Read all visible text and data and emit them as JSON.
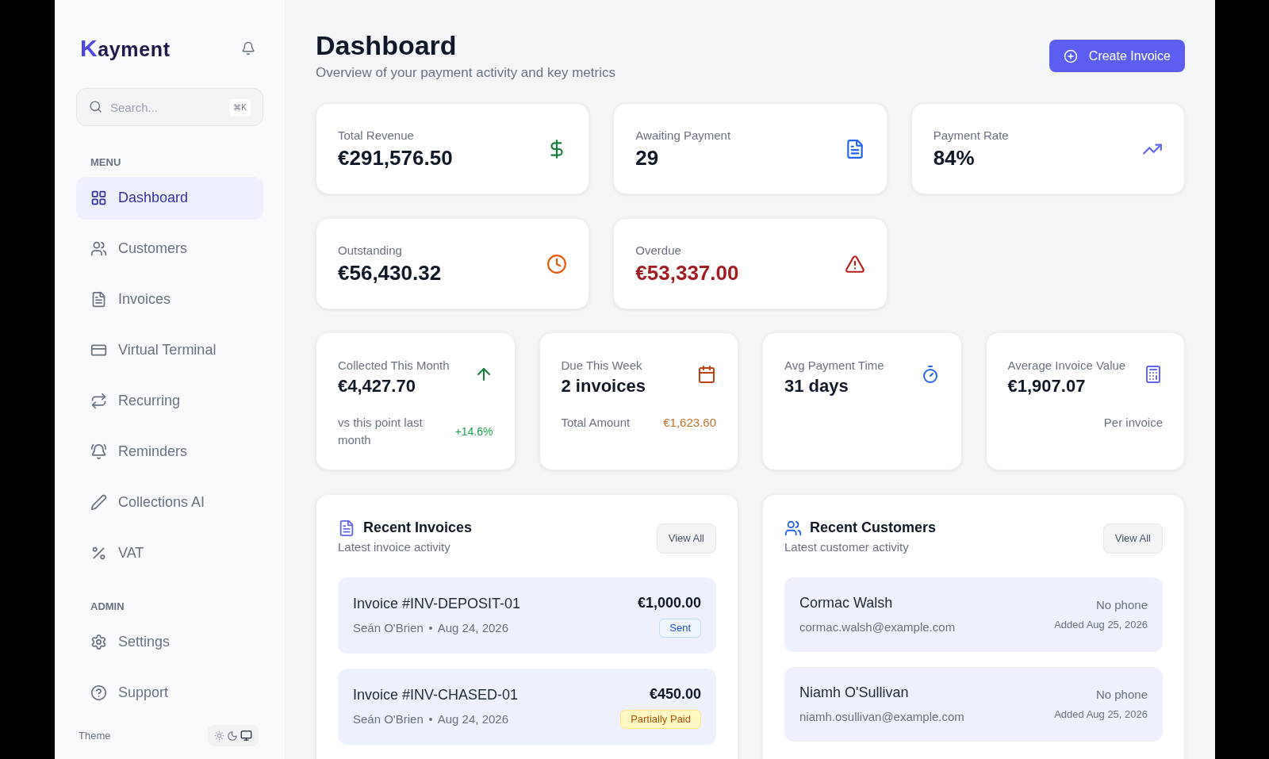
{
  "sidebar": {
    "brand": "Kayment",
    "search": {
      "placeholder": "Search...",
      "shortcut": "⌘K"
    },
    "sections": [
      {
        "title": "MENU",
        "items": [
          {
            "label": "Dashboard",
            "selected": true
          },
          {
            "label": "Customers",
            "selected": false
          },
          {
            "label": "Invoices",
            "selected": false
          },
          {
            "label": "Virtual Terminal",
            "selected": false
          },
          {
            "label": "Recurring",
            "selected": false
          },
          {
            "label": "Reminders",
            "selected": false
          },
          {
            "label": "Collections AI",
            "selected": false
          },
          {
            "label": "VAT",
            "selected": false
          }
        ]
      },
      {
        "title": "ADMIN",
        "items": [
          {
            "label": "Settings",
            "selected": false
          },
          {
            "label": "Support",
            "selected": false
          }
        ]
      }
    ],
    "theme_label": "Theme"
  },
  "header": {
    "title": "Dashboard",
    "subtitle": "Overview of your payment activity and key metrics",
    "action": "Create Invoice"
  },
  "metrics": [
    {
      "label": "Total Revenue",
      "value": "€291,576.50",
      "kind": "normal"
    },
    {
      "label": "Awaiting Payment",
      "value": "29",
      "kind": "normal"
    },
    {
      "label": "Payment Rate",
      "value": "84%",
      "kind": "normal"
    },
    {
      "label": "Outstanding",
      "value": "€56,430.32",
      "kind": "normal"
    },
    {
      "label": "Overdue",
      "value": "€53,337.00",
      "kind": "danger"
    }
  ],
  "details": [
    {
      "label": "Collected This Month",
      "value": "€4,427.70",
      "note": "vs this point last month",
      "extra": "+14.6%",
      "kind": "growth"
    },
    {
      "label": "Due This Week",
      "value": "2 invoices",
      "note": "Total Amount",
      "extra": "€1,623.60",
      "kind": "amount"
    },
    {
      "label": "Avg Payment Time",
      "value": "31 days",
      "kind": "plain"
    },
    {
      "label": "Average Invoice Value",
      "value": "€1,907.07",
      "extra": "Per invoice",
      "kind": "caption"
    }
  ],
  "recent_invoices": {
    "title": "Recent Invoices",
    "subtitle": "Latest invoice activity",
    "action": "View All",
    "items": [
      {
        "title": "Invoice #INV-DEPOSIT-01",
        "customer": "Seán O'Brien",
        "date": "Aug 24, 2026",
        "amount": "€1,000.00",
        "status": "Sent",
        "kind": "sent"
      },
      {
        "title": "Invoice #INV-CHASED-01",
        "customer": "Seán O'Brien",
        "date": "Aug 24, 2026",
        "amount": "€450.00",
        "status": "Partially Paid",
        "kind": "partial"
      }
    ]
  },
  "recent_customers": {
    "title": "Recent Customers",
    "subtitle": "Latest customer activity",
    "action": "View All",
    "items": [
      {
        "name": "Cormac Walsh",
        "email": "cormac.walsh@example.com",
        "phone": "No phone",
        "added": "Added Aug 25, 2026"
      },
      {
        "name": "Niamh O'Sullivan",
        "email": "niamh.osullivan@example.com",
        "phone": "No phone",
        "added": "Added Aug 25, 2026"
      }
    ]
  }
}
